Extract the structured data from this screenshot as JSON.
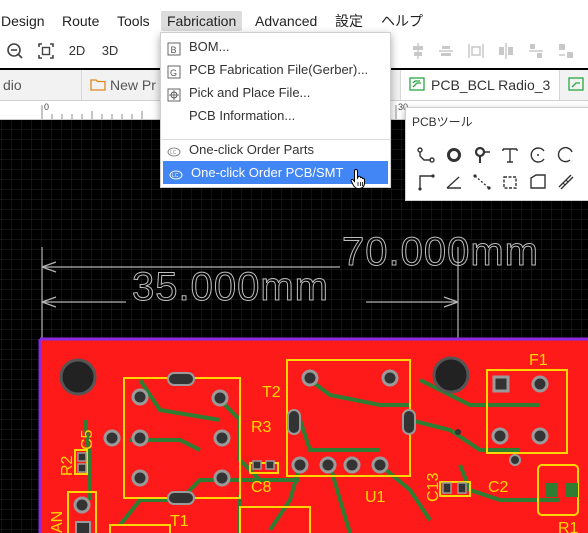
{
  "menubar": {
    "items": [
      "Design",
      "Route",
      "Tools",
      "Fabrication",
      "Advanced",
      "設定",
      "ヘルプ"
    ],
    "active_index": 3
  },
  "toolbar": {
    "view_2d": "2D",
    "view_3d": "3D"
  },
  "tabs": [
    {
      "label": "dio",
      "icon": "none"
    },
    {
      "label": "New Pr",
      "icon": "folder-icon"
    },
    {
      "label": "PCB_BCL Radio_3",
      "icon": "pcb-icon",
      "active": true
    },
    {
      "label": "",
      "icon": "pcb-icon"
    }
  ],
  "ruler": {
    "labels": [
      "0",
      "30"
    ]
  },
  "fabrication_menu": {
    "items": [
      {
        "label": "BOM...",
        "icon": "bom-icon"
      },
      {
        "label": "PCB Fabrication File(Gerber)...",
        "icon": "gerber-icon"
      },
      {
        "label": "Pick and Place File...",
        "icon": "pick-place-icon"
      },
      {
        "label": "PCB Information...",
        "icon": "none"
      },
      {
        "label": "One-click Order Parts",
        "icon": "order-parts-icon"
      },
      {
        "label": "One-click Order PCB/SMT",
        "icon": "order-pcb-icon",
        "highlighted": true
      }
    ]
  },
  "pcb_tools": {
    "title": "PCBツール",
    "tools": [
      "track-icon",
      "pad-icon",
      "via-icon",
      "text-icon",
      "arc-icon",
      "circle-arc-icon",
      "corner-icon",
      "angle-icon",
      "dashed-line-icon",
      "rect-icon",
      "polygon-icon",
      "measure-icon"
    ]
  },
  "canvas": {
    "dimension_70": "70.000mm",
    "dimension_35": "35.000mm",
    "designators": [
      "C5",
      "R2",
      "T2",
      "R3",
      "C8",
      "T1",
      "U1",
      "C13",
      "F1",
      "C2",
      "AN",
      "R1"
    ],
    "colors": {
      "board": "#ff1a1a",
      "silkscreen": "#ffd700",
      "track": "#2e7d32",
      "outline": "#8a2be2",
      "pad": "#9a9a9a"
    }
  }
}
